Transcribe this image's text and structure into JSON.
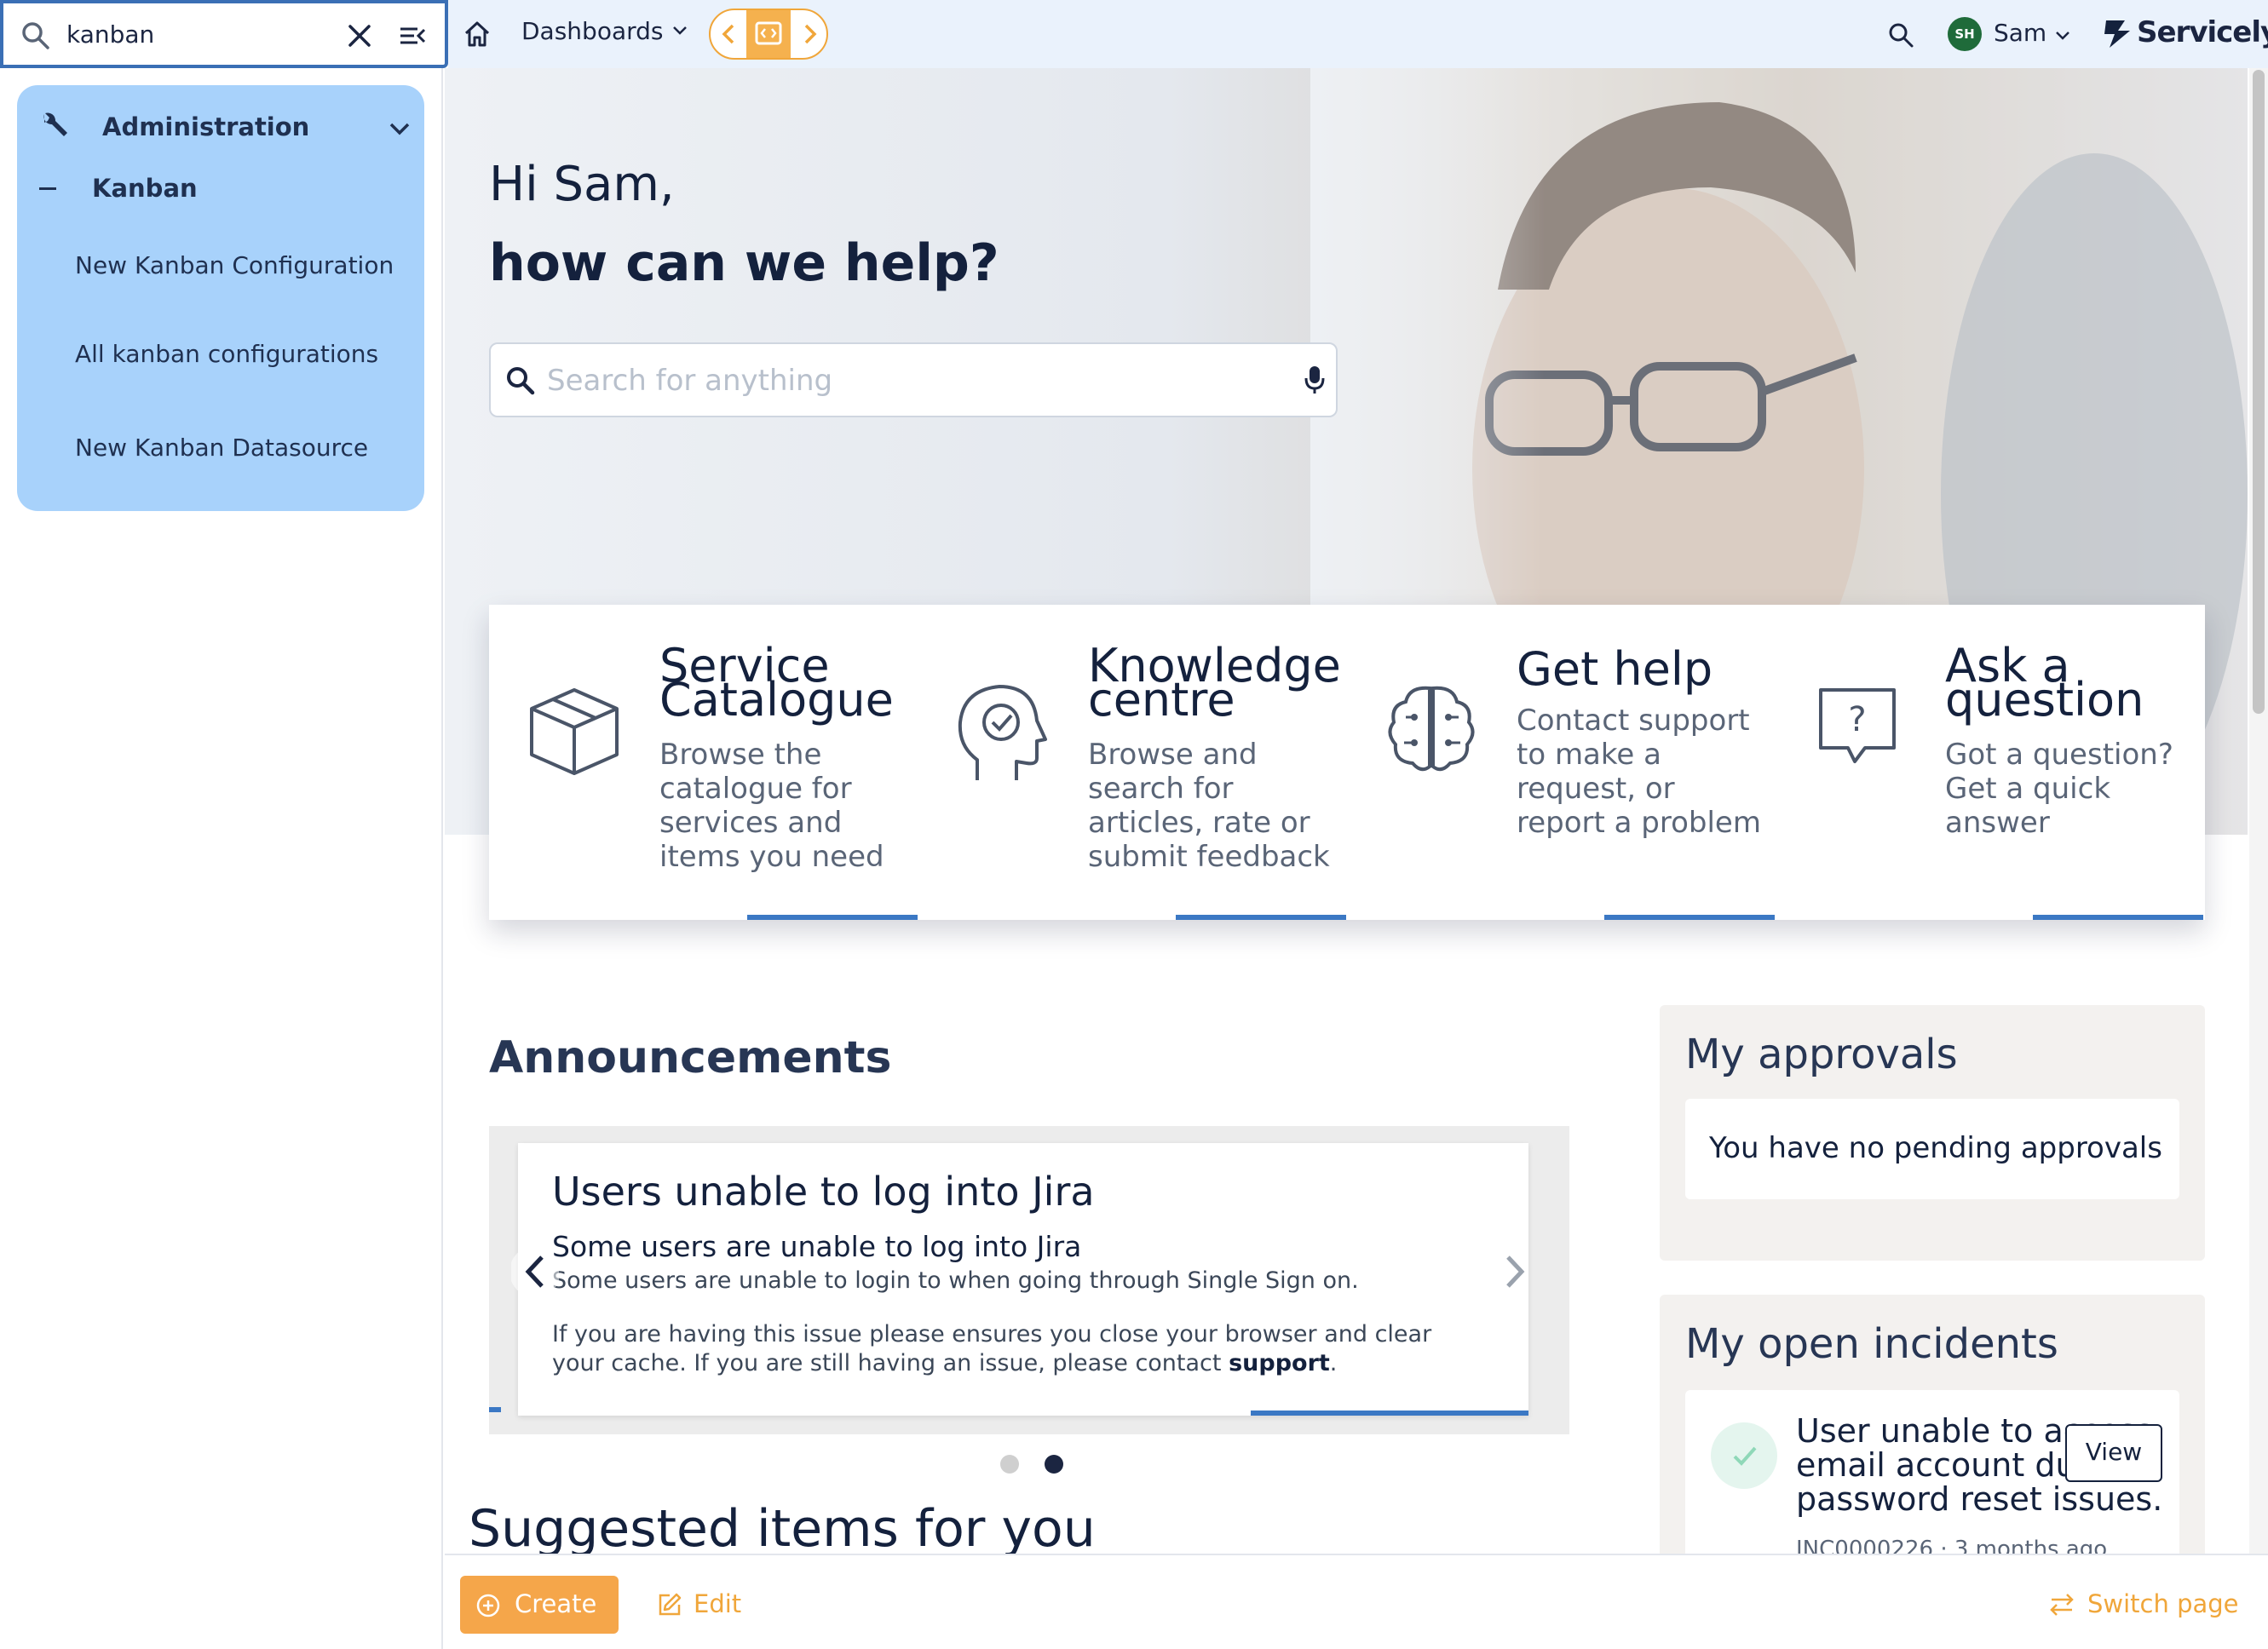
{
  "filter": {
    "value": "kanban",
    "placeholder": ""
  },
  "nav": {
    "section": "Administration",
    "group": "Kanban",
    "items": [
      {
        "label": "New Kanban Configuration"
      },
      {
        "label": "All kanban configurations"
      },
      {
        "label": "New Kanban Datasource"
      }
    ]
  },
  "topbar": {
    "dashboards": "Dashboards",
    "user": {
      "initials": "SH",
      "name": "Sam"
    },
    "brand": "Servicely"
  },
  "hero": {
    "greeting": "Hi Sam,",
    "help": "how can we help?",
    "search_placeholder": "Search for anything"
  },
  "tiles": [
    {
      "title": "Service Catalogue",
      "description": "Browse the catalogue for services and items you need",
      "icon": "box-icon"
    },
    {
      "title": "Knowledge centre",
      "description": "Browse and search for articles, rate or submit feedback",
      "icon": "head-check-icon"
    },
    {
      "title": "Get help",
      "description": "Contact support to make a request, or report a problem",
      "icon": "brain-icon"
    },
    {
      "title": "Ask a question",
      "description": "Got a question? Get a quick answer",
      "icon": "question-bubble-icon"
    }
  ],
  "announcements": {
    "heading": "Announcements",
    "title": "Users unable to log into Jira",
    "subtitle": "Some users are unable to log into Jira",
    "line1": "Some users are unable to login to when going through Single Sign on.",
    "line2": "If you are having this issue please ensures you close your browser and clear your cache.  If you are still having an issue, please contact",
    "link": "support",
    "line2_end": "."
  },
  "suggested": {
    "heading": "Suggested items for you"
  },
  "approvals": {
    "heading": "My approvals",
    "empty": "You have no pending approvals"
  },
  "incidents": {
    "heading": "My open incidents",
    "item_text": "User unable to access email account due to password reset issues.",
    "view_label": "View",
    "meta": "INC0000226 · 3 months ago"
  },
  "bottombar": {
    "create": "Create",
    "edit": "Edit",
    "switch": "Switch page"
  },
  "colors": {
    "accent": "#f5a64a",
    "nav_bg": "#a8d2fb",
    "topbar_bg": "#eaf2fc",
    "bar_blue": "#3b78c4"
  }
}
